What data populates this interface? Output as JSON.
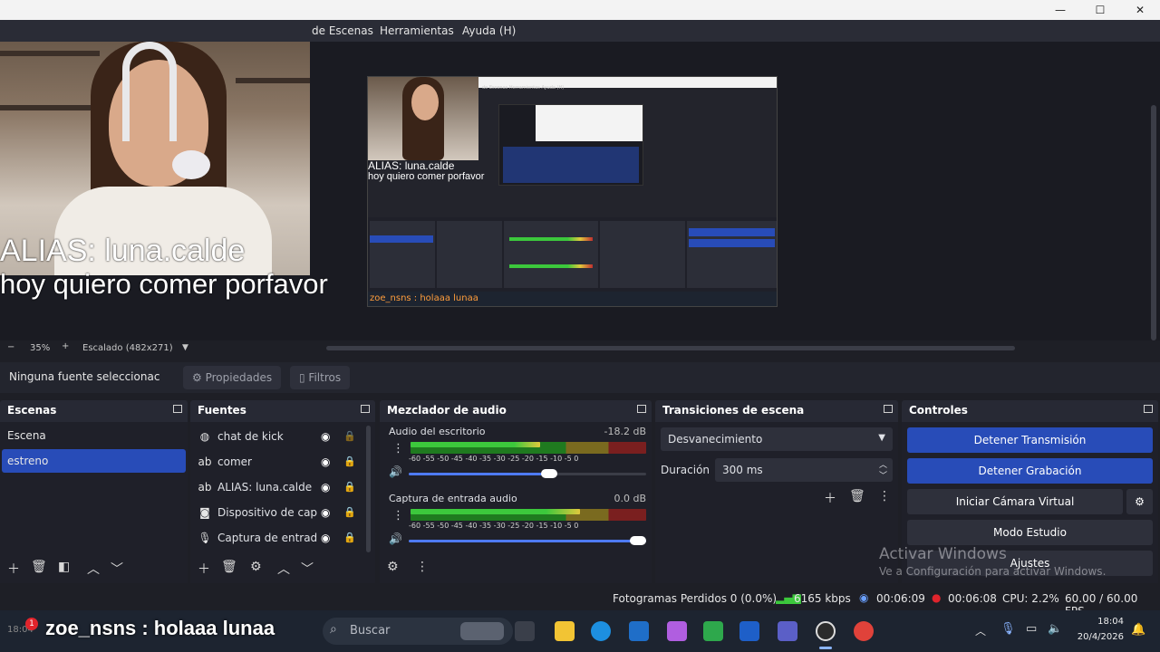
{
  "window": {
    "minimize": "—",
    "maximize": "☐",
    "close": "✕"
  },
  "menu": [
    {
      "label": "de Escenas"
    },
    {
      "label": "Herramientas"
    },
    {
      "label": "Ayuda (H)"
    }
  ],
  "overlay": {
    "alias": "ALIAS: luna.calde",
    "message": "hoy quiero comer porfavor",
    "chat": "zoe_nsns : holaaa lunaa"
  },
  "nested_preview": {
    "alias": "ALIAS: luna.calde",
    "message": "hoy quiero comer porfavor",
    "chat": "zoe_nsns : holaaa lunaa",
    "menu": "de Escenas  Herramientas  Ayuda (H)"
  },
  "zoom": {
    "minus": "−",
    "value": "35%",
    "plus": "+",
    "scale": "Escalado (482x271)",
    "dropdown": "▼"
  },
  "sourcebar": {
    "status": "Ninguna fuente seleccionac",
    "properties": "Propiedades",
    "filters": "Filtros"
  },
  "scenes": {
    "title": "Escenas",
    "items": [
      "Escena",
      "estreno"
    ]
  },
  "sources": {
    "title": "Fuentes",
    "items": [
      {
        "label": "chat de kick",
        "icon": "globe-icon"
      },
      {
        "label": "comer",
        "icon": "text-icon"
      },
      {
        "label": "ALIAS: luna.calde",
        "icon": "text-icon"
      },
      {
        "label": "Dispositivo de capt",
        "icon": "camera-icon"
      },
      {
        "label": "Captura de entrada",
        "icon": "microphone-icon"
      }
    ]
  },
  "mixer": {
    "title": "Mezclador de audio",
    "channels": [
      {
        "name": "Audio del escritorio",
        "db": "-18.2 dB",
        "level": 0.55,
        "volume": 0.6
      },
      {
        "name": "Captura de entrada audio",
        "db": "0.0 dB",
        "level": 0.72,
        "volume": 1.0
      }
    ],
    "scale": "-60  -55  -50  -45  -40  -35  -30  -25  -20  -15  -10  -5   0"
  },
  "transitions": {
    "title": "Transiciones de escena",
    "selected": "Desvanecimiento",
    "duration_label": "Duración",
    "duration_value": "300 ms"
  },
  "controls": {
    "title": "Controles",
    "stop_stream": "Detener Transmisión",
    "stop_record": "Detener Grabación",
    "virtual_cam": "Iniciar Cámara Virtual",
    "studio": "Modo Estudio",
    "settings": "Ajustes"
  },
  "watermark": {
    "title": "Activar Windows",
    "subtitle": "Ve a Configuración para activar Windows."
  },
  "status": {
    "dropped": "Fotogramas Perdidos 0 (0.0%)",
    "bitrate": "6165 kbps",
    "stream_time": "00:06:09",
    "record_time": "00:06:08",
    "cpu": "CPU: 2.2%",
    "fps": "60.00 / 60.00 FPS"
  },
  "taskbar": {
    "search": "Buscar",
    "time": "18:04",
    "date": "20/4/2026",
    "notification_count": "1",
    "left_time": "18:04"
  },
  "colors": {
    "accent": "#284cb8",
    "record_red": "#e0242c",
    "bitrate_green": "#3cc83c"
  }
}
